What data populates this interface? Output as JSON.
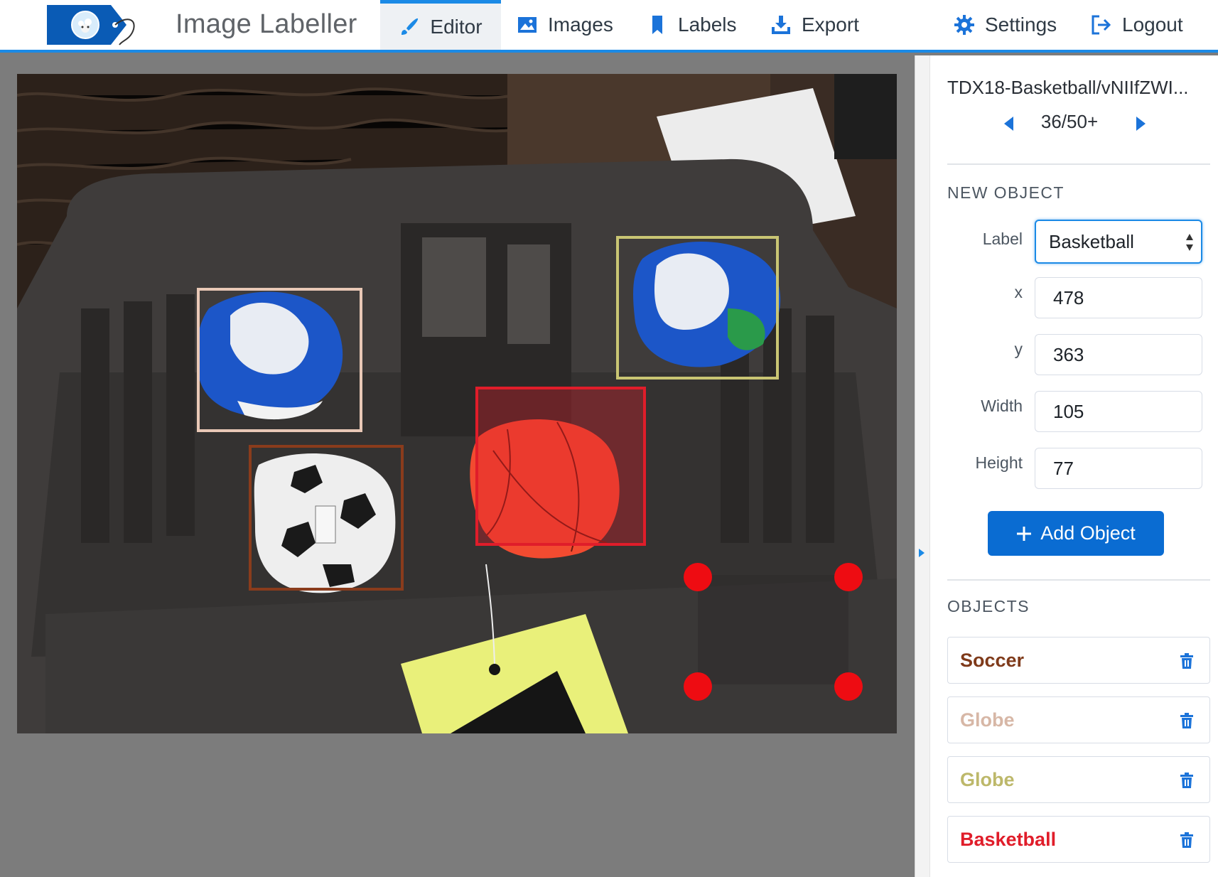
{
  "header": {
    "app_title": "Image Labeller",
    "nav": {
      "editor": "Editor",
      "images": "Images",
      "labels": "Labels",
      "export": "Export",
      "settings": "Settings",
      "logout": "Logout"
    },
    "active_tab": "Editor",
    "accent_color": "#1b8ae6"
  },
  "sidebar": {
    "file_name": "TDX18-Basketball/vNIIfZWI...",
    "page_counter": "36/50+",
    "new_object": {
      "heading": "NEW OBJECT",
      "label_caption": "Label",
      "label_value": "Basketball",
      "x_caption": "x",
      "x_value": "478",
      "y_caption": "y",
      "y_value": "363",
      "width_caption": "Width",
      "width_value": "105",
      "height_caption": "Height",
      "height_value": "77",
      "add_button": "Add Object"
    },
    "objects_heading": "OBJECTS",
    "objects": [
      {
        "label": "Soccer",
        "color": "#7f3a1a"
      },
      {
        "label": "Globe",
        "color": "#d7b7a6"
      },
      {
        "label": "Globe",
        "color": "#bdb86a"
      },
      {
        "label": "Basketball",
        "color": "#e01d2a"
      }
    ]
  },
  "canvas": {
    "box_colors": {
      "globe_left": "#e9c8b6",
      "soccer": "#8a3c1c",
      "globe_right": "#c9c573",
      "basketball": "#e01d2a",
      "handle": "#ee0c12"
    }
  }
}
